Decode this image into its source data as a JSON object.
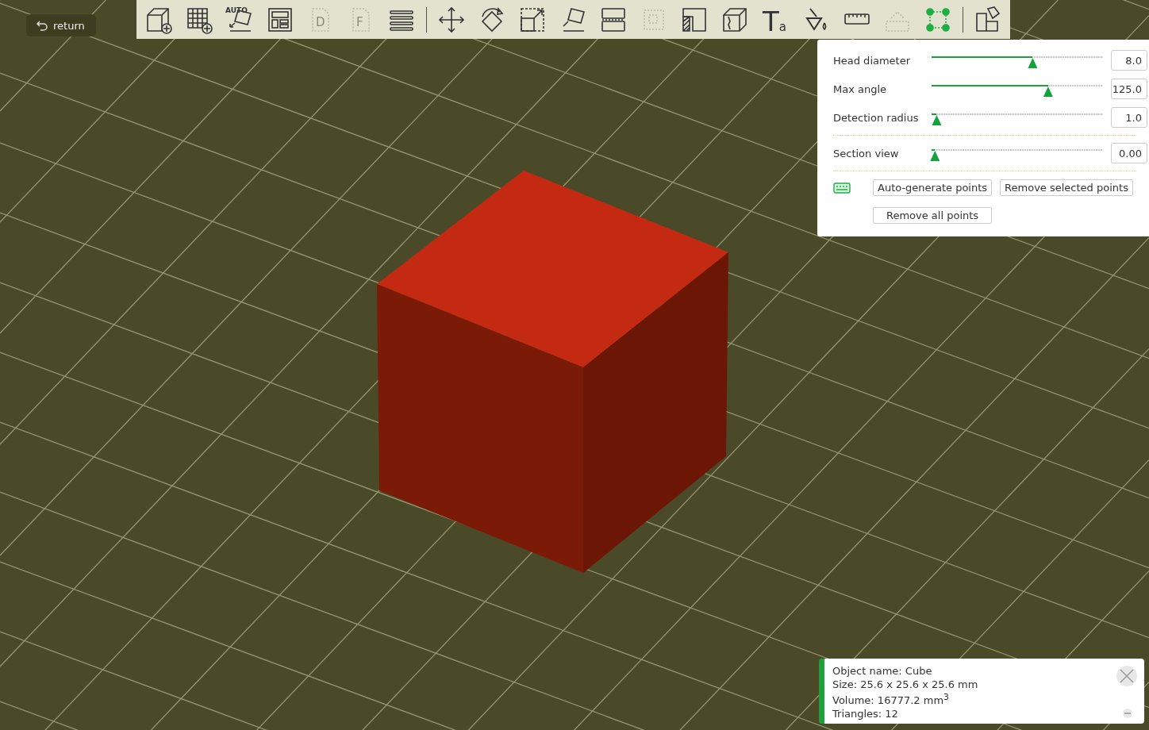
{
  "return_button": {
    "label": "return"
  },
  "toolbar": [
    {
      "kind": "add-object",
      "disabled": false,
      "selected": false
    },
    {
      "kind": "add-plate",
      "disabled": false,
      "selected": false
    },
    {
      "kind": "auto-orient",
      "disabled": false,
      "selected": false,
      "glyph": "AUTO"
    },
    {
      "kind": "arrange",
      "disabled": false,
      "selected": false
    },
    {
      "kind": "page",
      "disabled": true,
      "selected": false,
      "glyph": "D"
    },
    {
      "kind": "page",
      "disabled": true,
      "selected": false,
      "glyph": "F"
    },
    {
      "kind": "layers",
      "disabled": false,
      "selected": false
    },
    {
      "kind": "separator"
    },
    {
      "kind": "move",
      "disabled": false,
      "selected": false
    },
    {
      "kind": "rotate",
      "disabled": false,
      "selected": false
    },
    {
      "kind": "scale",
      "disabled": false,
      "selected": false
    },
    {
      "kind": "lay-on-face",
      "disabled": false,
      "selected": false
    },
    {
      "kind": "split",
      "disabled": false,
      "selected": false
    },
    {
      "kind": "cut",
      "disabled": true,
      "selected": false
    },
    {
      "kind": "support-paint",
      "disabled": false,
      "selected": false
    },
    {
      "kind": "seam",
      "disabled": false,
      "selected": false
    },
    {
      "kind": "text",
      "disabled": false,
      "selected": false,
      "glyph": "Ta"
    },
    {
      "kind": "paint",
      "disabled": false,
      "selected": false
    },
    {
      "kind": "measure",
      "disabled": false,
      "selected": false
    },
    {
      "kind": "assembly",
      "disabled": true,
      "selected": false
    },
    {
      "kind": "support-points",
      "disabled": false,
      "selected": true
    },
    {
      "kind": "separator"
    },
    {
      "kind": "puzzle",
      "disabled": false,
      "selected": false
    }
  ],
  "settings_panel": {
    "groups": [
      [
        {
          "label": "Head diameter",
          "level": 0.59,
          "value": "8.0"
        },
        {
          "label": "Max angle",
          "level": 0.68,
          "value": "125.0"
        },
        {
          "label": "Detection radius",
          "level": 0.03,
          "value": "1.0"
        }
      ],
      [
        {
          "label": "Section view",
          "level": 0.02,
          "value": "0.00"
        }
      ]
    ],
    "buttons": [
      "Auto-generate points",
      "Remove selected points",
      "Remove all points"
    ]
  },
  "object_info": {
    "lines": [
      "Object name: Cube",
      "Size: 25.6 x 25.6 x 25.6 mm",
      "Volume: 16777.2 mm$^{3}$",
      "Triangles: 12"
    ]
  }
}
